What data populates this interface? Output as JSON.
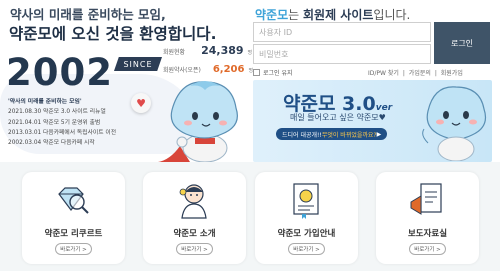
{
  "hero": {
    "line1": "약사의 미래를 준비하는 모임,",
    "line2": "약준모에 오신 것을 환영합니다.",
    "year": "2002",
    "since": "SINCE",
    "members_label": "회원현황",
    "members_value": "24,389",
    "members_unit": "명",
    "pharmacist_label": "회원약사(오픈)",
    "pharmacist_value": "6,206",
    "pharmacist_unit": "명",
    "history_title": "'약사의 미래를 준비하는 모임'",
    "history": [
      "2021.08.30 약준모 3.0 사이트 리뉴얼",
      "2021.04.01 약준모 5기 운영위 출범",
      "2013.03.01 다음카페에서 독립사이트 이전",
      "2002.03.04 약준모 다음카페 시작"
    ]
  },
  "login": {
    "title_brand": "약준모",
    "title_middle": "는 ",
    "title_bold": "회원제 사이트",
    "title_end": "입니다.",
    "id_placeholder": "사용자 ID",
    "pw_placeholder": "비밀번호",
    "login_button": "로그인",
    "keep_login": "로그인 유지",
    "links": [
      "ID/PW 찾기",
      "|",
      "가입문의",
      "|",
      "회원가입"
    ]
  },
  "banner": {
    "title": "약준모 3.0",
    "ver": "ver",
    "subtitle": "매일 들어오고 싶은 약준모♥",
    "pill_a": "드디어 대공개!! ",
    "pill_b": "무엇이 바뀌었을까요?",
    "pill_c": " ▶"
  },
  "cards": [
    {
      "label": "약준모 리쿠르트",
      "button": "바로가기 >",
      "icon": "diamond-magnifier-icon"
    },
    {
      "label": "약준모 소개",
      "button": "바로가기 >",
      "icon": "pharmacist-character-icon"
    },
    {
      "label": "약준모 가입안내",
      "button": "바로가기 >",
      "icon": "certificate-icon"
    },
    {
      "label": "보도자료실",
      "button": "바로가기 >",
      "icon": "megaphone-document-icon"
    }
  ],
  "colors": {
    "navy": "#2c3d55",
    "accent_blue": "#3ea3d8",
    "orange": "#e06a2a",
    "button": "#3f5468"
  }
}
